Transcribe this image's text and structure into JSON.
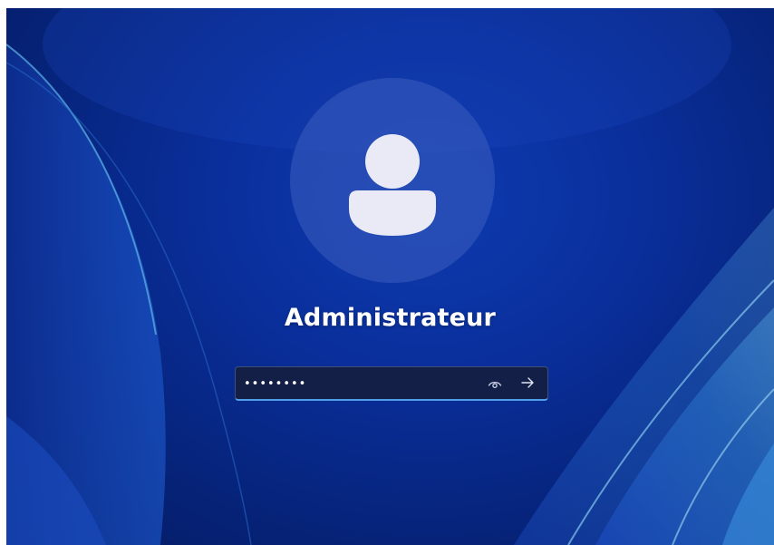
{
  "user": {
    "name": "Administrateur"
  },
  "password": {
    "value": "••••••••",
    "masked_length": 8
  },
  "icons": {
    "avatar": "user-silhouette-icon",
    "reveal": "eye-reveal-icon",
    "submit": "arrow-right-icon"
  },
  "colors": {
    "background": "#0a2f9c",
    "accent": "#4f9fe8",
    "avatar_glyph": "#e9eaf6"
  }
}
